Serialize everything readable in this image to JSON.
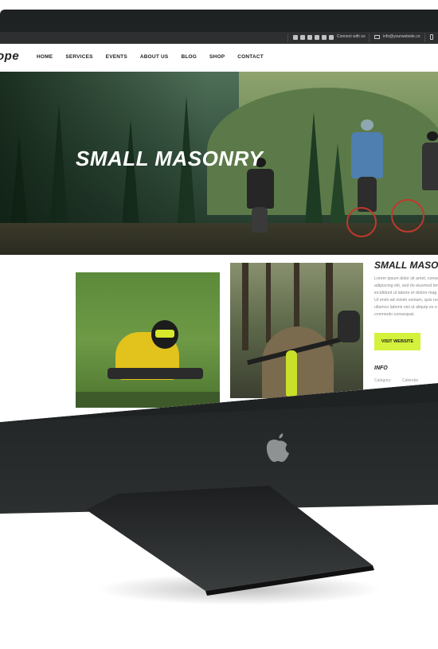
{
  "topbar": {
    "connect_label": "Connect with us",
    "email": "info@yourwebsite.co",
    "social_icons": [
      "vimeo-icon",
      "skype-icon",
      "facebook-icon",
      "pinterest-icon",
      "youtube-icon",
      "twitter-icon"
    ]
  },
  "site": {
    "logo_text": "ope"
  },
  "nav": {
    "items": [
      "HOME",
      "SERVICES",
      "EVENTS",
      "ABOUT US",
      "BLOG",
      "SHOP",
      "CONTACT"
    ]
  },
  "hero": {
    "title": "SMALL MASONRY"
  },
  "sidebar": {
    "title": "SMALL MASON",
    "lines": [
      "Lorem ipsum dolor sit amet, consec",
      "adipiscing elit, sed do eiusmod tem",
      "incididunt ut labore et dolore mag",
      "Ut enim ad minim veniam, quis nos",
      "ullamco laboris nisi ut aliquip ex e",
      "commodo consequat."
    ],
    "button_label": "VISIT WEBSITE",
    "info_title": "INFO",
    "info_label": "Category:",
    "info_value": "Calendar"
  },
  "colors": {
    "accent": "#d4f23b",
    "topbar_bg": "#2d2f30",
    "bezel": "#1f2223"
  }
}
